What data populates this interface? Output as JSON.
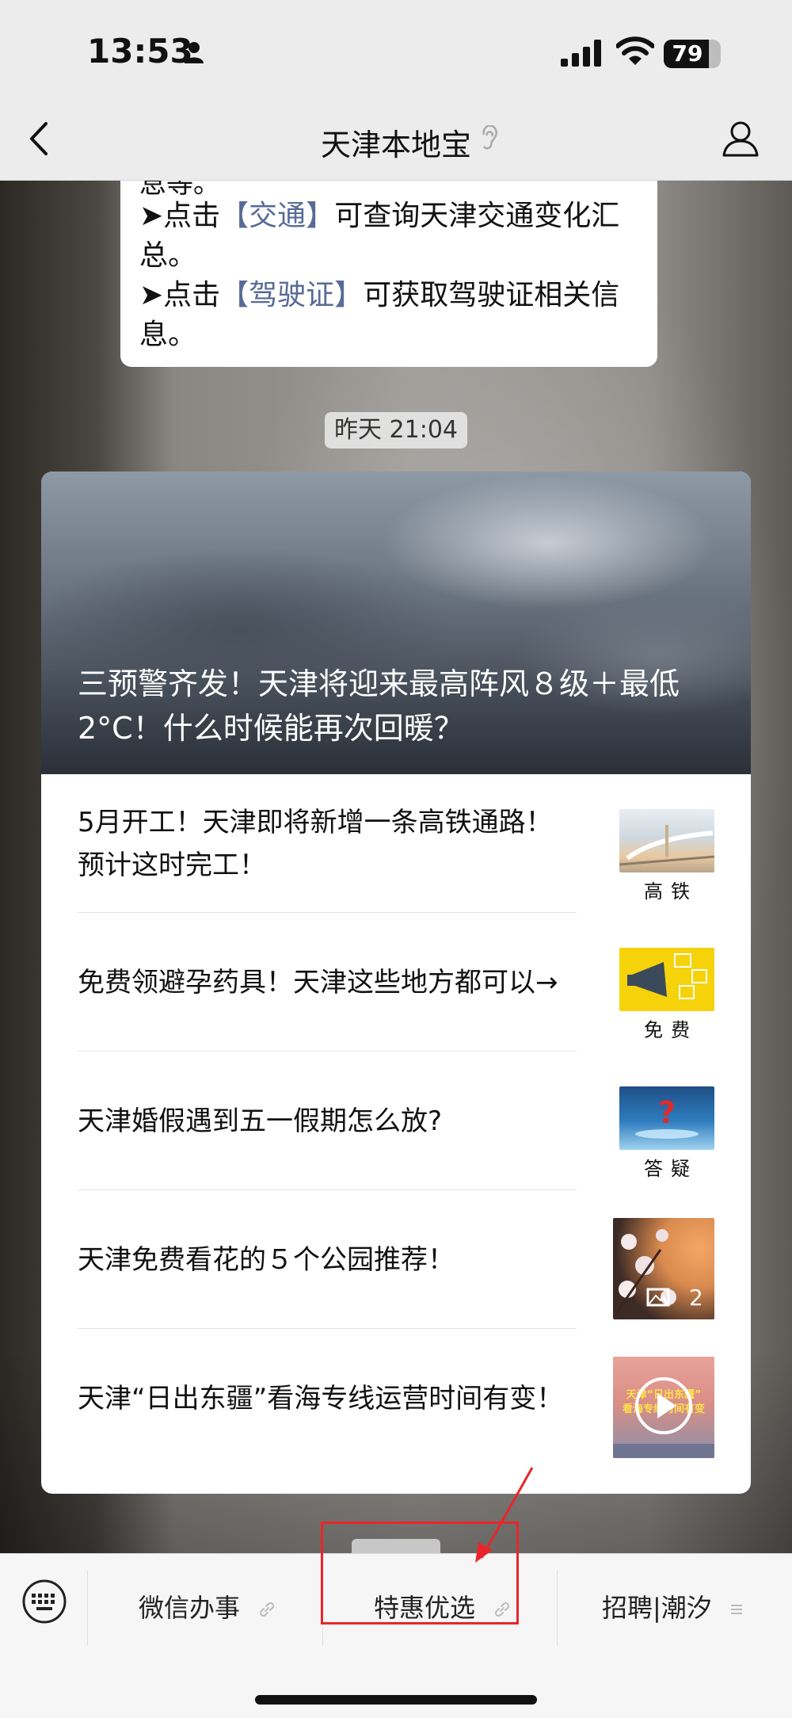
{
  "status_bar": {
    "time": "13:53",
    "battery": "79"
  },
  "nav": {
    "title": "天津本地宝"
  },
  "message": {
    "cut_line": "息等。",
    "line1_prefix": "➤点击",
    "line1_link": "【交通】",
    "line1_suffix": "可查询天津交通变化汇",
    "line1_cont": "总。",
    "line2_prefix": "➤点击",
    "line2_link": "【驾驶证】",
    "line2_suffix": "可获取驾驶证相关信",
    "line2_cont": "息。"
  },
  "timestamp": "昨天 21:04",
  "article_card": {
    "hero_title": "三预警齐发！天津将迎来最高阵风８级＋最低2°C！什么时候能再次回暖？",
    "items": [
      {
        "title": "5月开工！天津即将新增一条高铁通路！预计这时完工！",
        "thumb_label": "高铁",
        "thumb_icon": "high-speed-train-thumbnail"
      },
      {
        "title": "免费领避孕药具！天津这些地方都可以→",
        "thumb_label": "免费",
        "thumb_icon": "megaphone-thumbnail"
      },
      {
        "title": "天津婚假遇到五一假期怎么放?",
        "thumb_label": "答疑",
        "thumb_icon": "question-mark-thumbnail"
      },
      {
        "title": "天津免费看花的５个公园推荐！",
        "thumb_count": "2",
        "thumb_icon": "flowers-photo-thumbnail"
      },
      {
        "title": "天津“日出东疆”看海专线运营时间有变！",
        "thumb_text_1": "天津“日出东疆”",
        "thumb_text_2": "看海专线时间有变",
        "thumb_icon": "video-thumbnail"
      }
    ]
  },
  "bottom_menu": {
    "items": [
      "微信办事",
      "特惠优选",
      "招聘|潮汐"
    ]
  },
  "colors": {
    "link": "#576b95",
    "highlight": "#e8262a"
  }
}
